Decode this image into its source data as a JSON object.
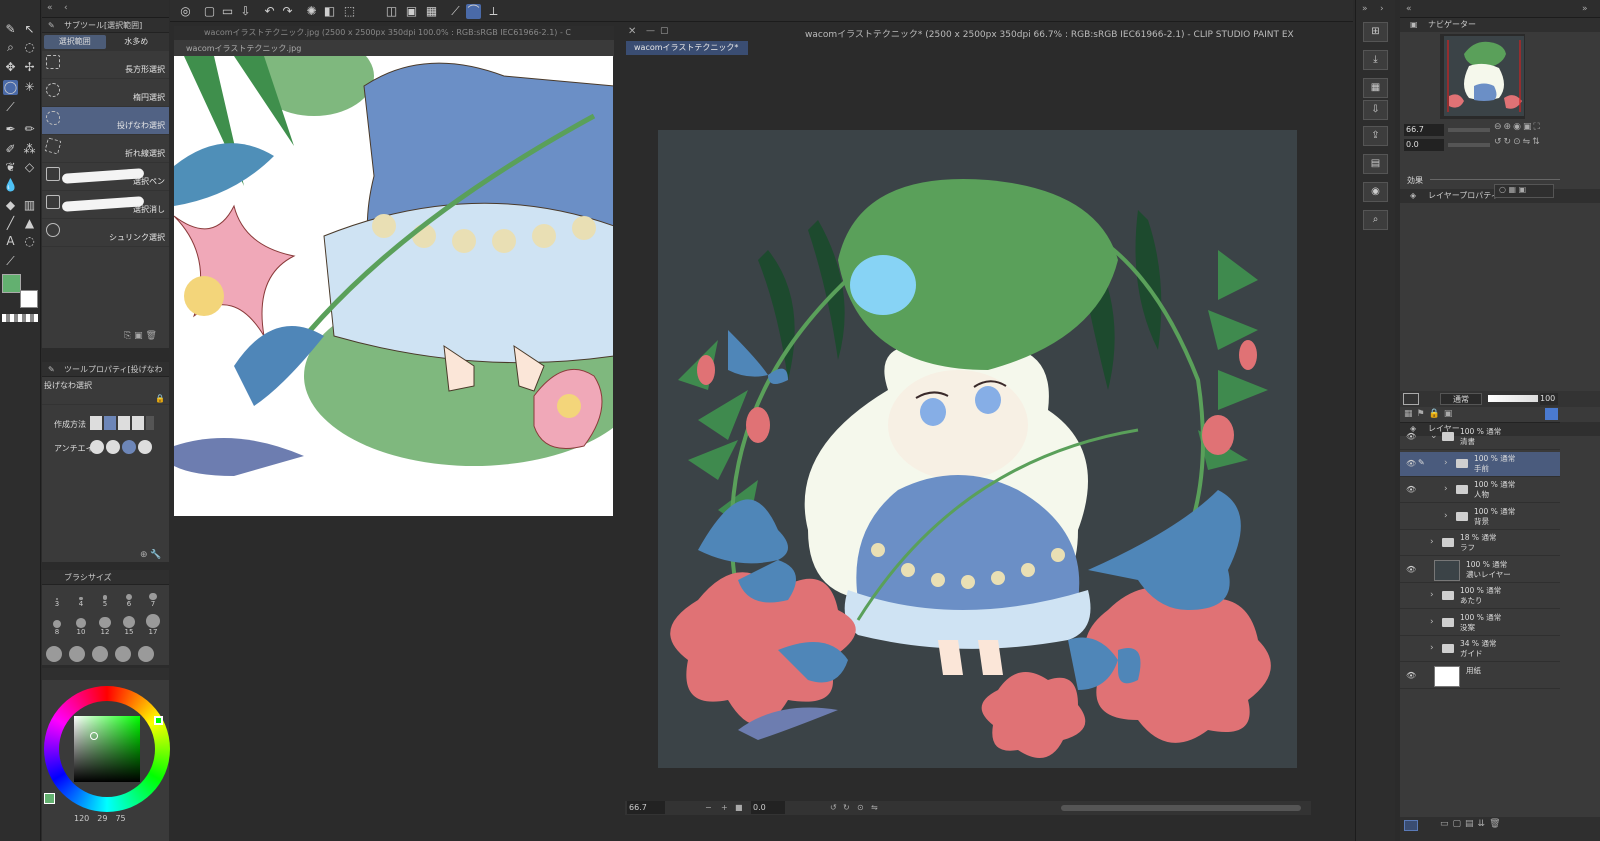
{
  "app": {
    "title": "wacomイラストテクニック* (2500 x 2500px 350dpi 66.7% : RGB:sRGB IEC61966-2.1)  - CLIP STUDIO PAINT EX"
  },
  "subtool": {
    "title": "サブツール[選択範囲]",
    "tabs": [
      "選択範囲",
      "水多め"
    ],
    "items": [
      {
        "label": "長方形選択",
        "icon": "rect-select-icon"
      },
      {
        "label": "楕円選択",
        "icon": "ellipse-select-icon"
      },
      {
        "label": "投げなわ選択",
        "icon": "lasso-icon"
      },
      {
        "label": "折れ線選択",
        "icon": "polyline-select-icon"
      },
      {
        "label": "選択ペン",
        "icon": "select-pen-icon"
      },
      {
        "label": "選択消し",
        "icon": "select-erase-icon"
      },
      {
        "label": "シュリンク選択",
        "icon": "shrink-select-icon"
      }
    ]
  },
  "toolprop": {
    "title": "ツールプロパティ[投げなわ",
    "name": "投げなわ選択",
    "mode_label": "作成方法",
    "aa_label": "アンチエイ"
  },
  "brushsize": {
    "title": "ブラシサイズ",
    "sizes": [
      "3",
      "4",
      "5",
      "6",
      "7",
      "8",
      "10",
      "12",
      "15",
      "17"
    ]
  },
  "color": {
    "fg": "#63b070",
    "bg": "#ffffff",
    "hsv": [
      "120",
      "29",
      "75"
    ]
  },
  "left_doc": {
    "window_title": "wacomイラストテクニック.jpg (2500 x 2500px 350dpi 100.0% : RGB:sRGB IEC61966-2.1) - C",
    "tab": "wacomイラストテクニック.jpg"
  },
  "main_doc": {
    "tab": "wacomイラストテクニック*",
    "zoom": "66.7",
    "angle": "0.0"
  },
  "navigator": {
    "title": "ナビゲーター",
    "zoom": "66.7",
    "angle": "0.0"
  },
  "layerprop": {
    "title": "レイヤープロパティ",
    "effect_label": "効果"
  },
  "layers": {
    "title": "レイヤー",
    "blend": "通常",
    "opacity": "100",
    "items": [
      {
        "mode": "100 % 通常",
        "name": "清書",
        "kind": "folder",
        "visible": true,
        "selected": false,
        "indent": 0
      },
      {
        "mode": "100 % 通常",
        "name": "手前",
        "kind": "folder",
        "visible": true,
        "selected": true,
        "indent": 1
      },
      {
        "mode": "100 % 通常",
        "name": "人物",
        "kind": "folder",
        "visible": true,
        "selected": false,
        "indent": 1
      },
      {
        "mode": "100 % 通常",
        "name": "背景",
        "kind": "folder",
        "visible": false,
        "selected": false,
        "indent": 1
      },
      {
        "mode": "18 % 通常",
        "name": "ラフ",
        "kind": "folder",
        "visible": false,
        "selected": false,
        "indent": 0
      },
      {
        "mode": "100 % 通常",
        "name": "濃いレイヤー",
        "kind": "layer",
        "visible": true,
        "selected": false,
        "indent": 0
      },
      {
        "mode": "100 % 通常",
        "name": "あたり",
        "kind": "folder",
        "visible": false,
        "selected": false,
        "indent": 0
      },
      {
        "mode": "100 % 通常",
        "name": "没案",
        "kind": "folder",
        "visible": false,
        "selected": false,
        "indent": 0
      },
      {
        "mode": "34 % 通常",
        "name": "ガイド",
        "kind": "folder",
        "visible": false,
        "selected": false,
        "indent": 0
      },
      {
        "mode": "",
        "name": "用紙",
        "kind": "paper",
        "visible": true,
        "selected": false,
        "indent": 0
      }
    ]
  }
}
